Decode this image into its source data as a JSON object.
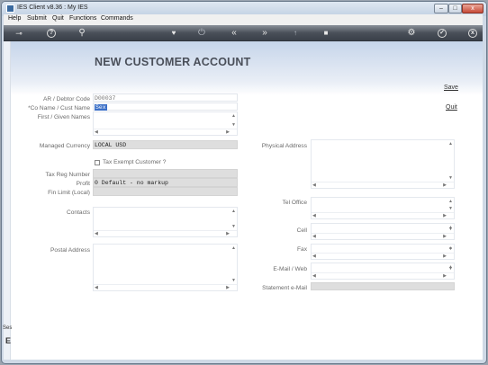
{
  "window": {
    "title": "IES Client v8.36 : My IES",
    "min": "–",
    "max": "□",
    "close": "x"
  },
  "menu": [
    "Help",
    "Submit",
    "Quit",
    "Functions",
    "Commands"
  ],
  "toolbar": {
    "icons": [
      "key-icon",
      "help-icon",
      "search-icon",
      "heart-icon",
      "power-icon",
      "rewind-icon",
      "fast-forward-icon",
      "upload-icon",
      "stop-icon",
      "gear-icon",
      "check-icon",
      "close-icon"
    ],
    "help": "?",
    "check": "✓",
    "close": "x"
  },
  "form": {
    "title": "NEW CUSTOMER ACCOUNT",
    "save": "Save",
    "quit": "Quit",
    "labels": {
      "debtor_code": "AR / Debtor Code",
      "co_name": "*Co Name / Cust Name",
      "first_name": "First / Given Names",
      "currency": "Managed Currency",
      "tax_exempt": "Tax Exempt Customer ?",
      "tax_reg": "Tax Reg Number",
      "profit": "Profit",
      "fin_limit": "Fin Limit (Local)",
      "contacts": "Contacts",
      "postal": "Postal Address",
      "physical": "Physical Address",
      "tel_office": "Tel Office",
      "cell": "Cell",
      "fax": "Fax",
      "email": "E-Mail / Web",
      "statement_email": "Statement e-Mail"
    },
    "values": {
      "debtor_code": "D00037",
      "co_name": "Sex",
      "currency": "LOCAL USD",
      "profit": "0 Default - no markup"
    }
  },
  "left_strip": {
    "text": "Ses",
    "icon": "E"
  }
}
